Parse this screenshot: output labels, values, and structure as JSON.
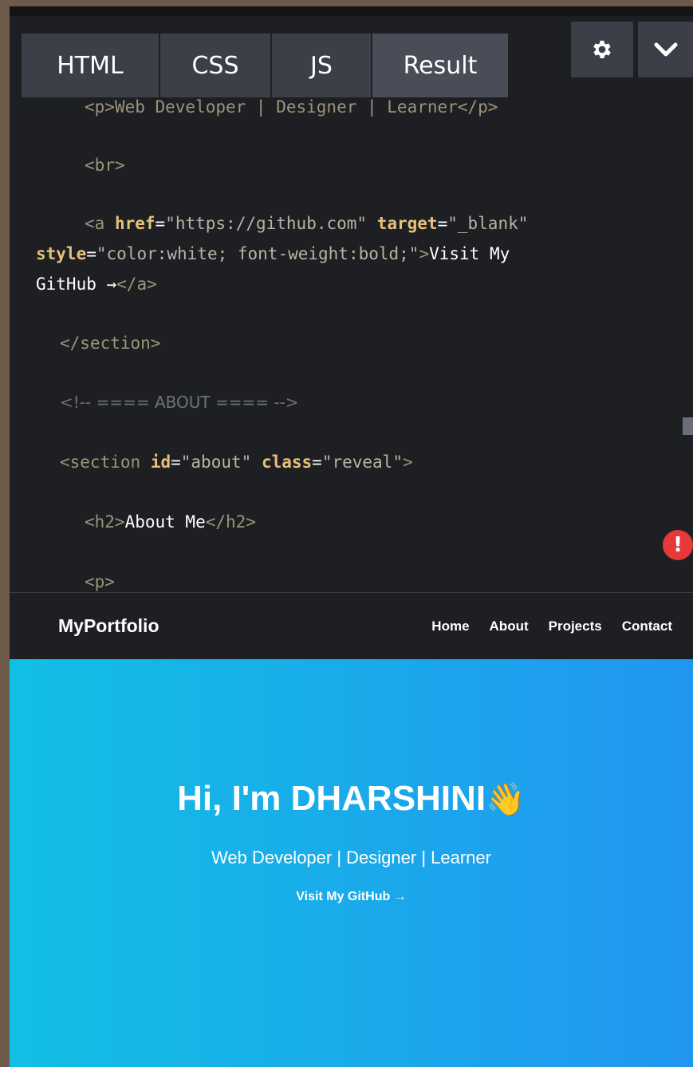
{
  "tabs": [
    "HTML",
    "CSS",
    "JS",
    "Result"
  ],
  "icons": {
    "settings": "gear-icon",
    "collapse": "chevron-down-icon",
    "error": "exclamation-icon"
  },
  "code": {
    "line1": "<p>Web Developer | Designer | Learner</p>",
    "br": "<br>",
    "a_open": "<a",
    "href_attr": "href",
    "href_val": "\"https://github.com\"",
    "target_attr": "target",
    "target_val": "\"_blank\"",
    "style_attr": "style",
    "style_val": "\"color:white; font-weight:bold;\"",
    "gt": ">",
    "link_text_1": "Visit My",
    "link_text_2": "GitHub →",
    "a_close": "</a>",
    "section_close": "</section>",
    "comment": "<!-- ==== ABOUT ==== -->",
    "section_open": "<section",
    "id_attr": "id",
    "id_val": "\"about\"",
    "class_attr": "class",
    "class_val": "\"reveal\"",
    "h2_open": "<h2>",
    "h2_text": "About Me",
    "h2_close": "</h2>",
    "p_open": "<p>",
    "eq": "="
  },
  "error_badge": "!",
  "preview": {
    "brand": "MyPortfolio",
    "nav": [
      "Home",
      "About",
      "Projects",
      "Contact"
    ],
    "hero_title": "Hi, I'm DHARSHINI",
    "hero_emoji": "👋",
    "hero_subtitle": "Web Developer | Designer | Learner",
    "hero_link": "Visit My GitHub →"
  }
}
